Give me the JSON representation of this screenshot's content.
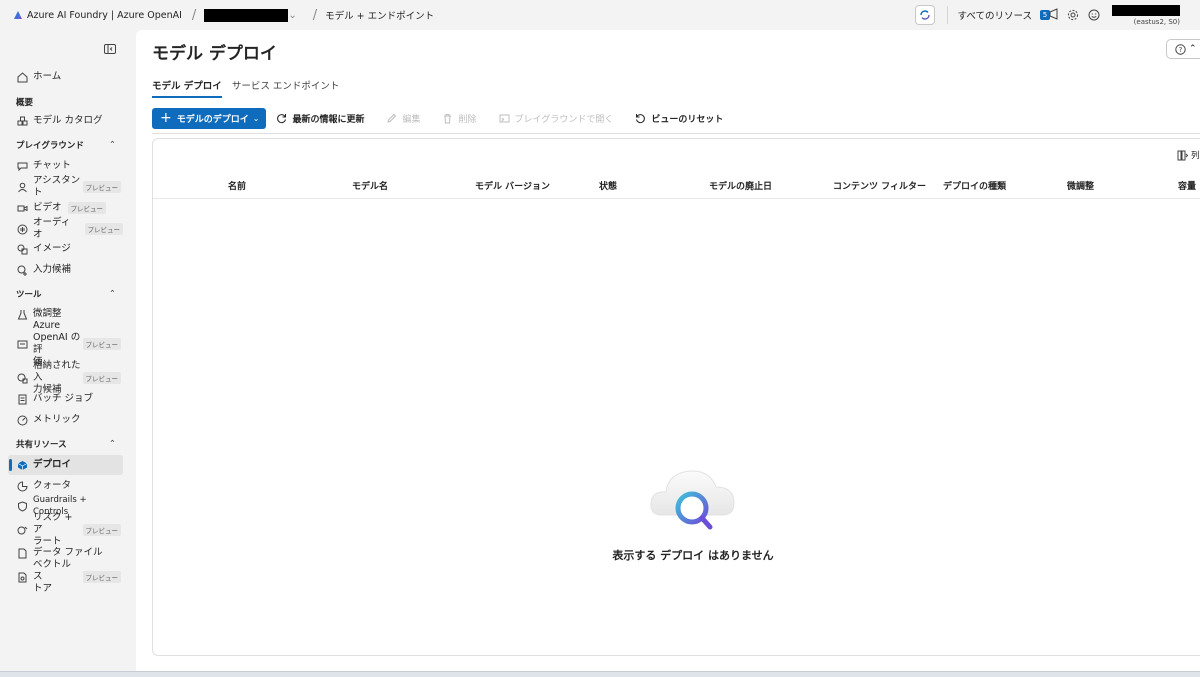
{
  "topbar": {
    "brand": "Azure AI Foundry | Azure OpenAI",
    "breadcrumb_separator": "/",
    "breadcrumb_page": "モデル + エンドポイント",
    "all_resources": "すべてのリソース",
    "announcement_count": "5",
    "account_sub": "(eastus2, S0)",
    "accent": "#0f6cbd"
  },
  "sidebar": {
    "home": "ホーム",
    "overview_header": "概要",
    "model_catalog": "モデル カタログ",
    "playground_header": "プレイグラウンド",
    "chat": "チャット",
    "assistant": "アシスタント",
    "video": "ビデオ",
    "audio": "オーディオ",
    "image": "イメージ",
    "completions": "入力候補",
    "tools_header": "ツール",
    "finetune": "微調整",
    "eval_line1": "Azure",
    "eval_line2": "OpenAI の評",
    "eval_line3": "価",
    "stored_line1": "格納された入",
    "stored_line2": "力候補",
    "batch": "バッチ ジョブ",
    "metrics": "メトリック",
    "shared_header": "共有リソース",
    "deployments": "デプロイ",
    "quota": "クォータ",
    "guardrails": "Guardrails + Controls",
    "risk_line1": "リスク + ア",
    "risk_line2": "ラート",
    "data_files": "データ ファイル",
    "vector_line1": "ベクトル ス",
    "vector_line2": "トア",
    "preview": "プレビュー"
  },
  "main": {
    "title": "モデル デプロイ",
    "tabs": [
      "モデル デプロイ",
      "サービス エンドポイント"
    ],
    "toolbar": {
      "deploy": "モデルのデプロイ",
      "refresh": "最新の情報に更新",
      "edit": "編集",
      "delete": "削除",
      "open_playground": "プレイグラウンドで開く",
      "reset_view": "ビューのリセット"
    },
    "columns_button": "列",
    "columns": [
      "名前",
      "モデル名",
      "モデル バージョン",
      "状態",
      "モデルの廃止日",
      "コンテンツ フィルター",
      "デプロイの種類",
      "微調整",
      "容量"
    ],
    "empty_message": "表示する デプロイ はありません"
  }
}
